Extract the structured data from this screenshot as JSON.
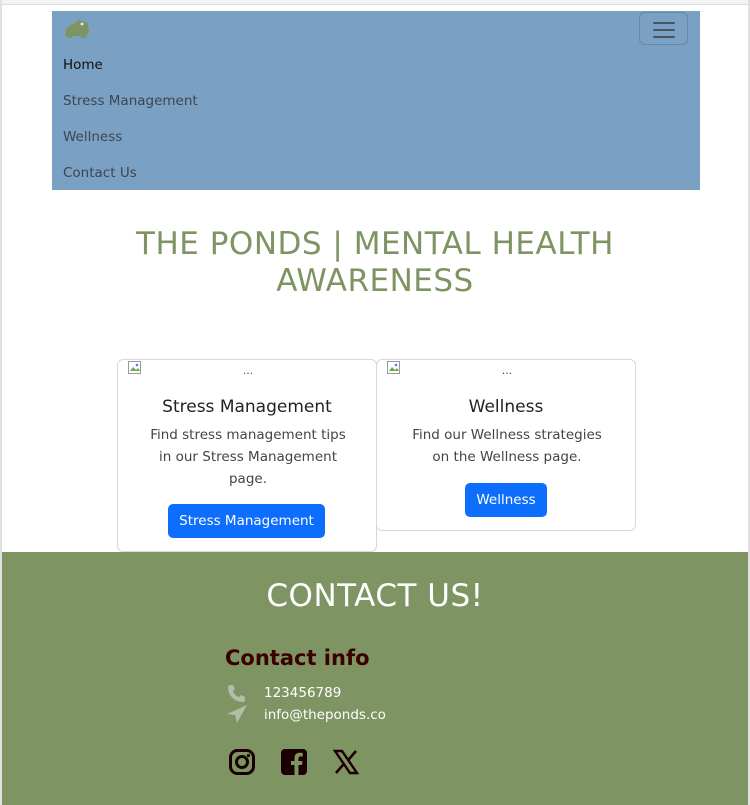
{
  "nav": {
    "items": [
      {
        "label": "Home",
        "active": true
      },
      {
        "label": "Stress Management",
        "active": false
      },
      {
        "label": "Wellness",
        "active": false
      },
      {
        "label": "Contact Us",
        "active": false
      }
    ],
    "brand_icon": "frog-icon",
    "toggler_icon": "hamburger-icon",
    "background": "#7aa0c4"
  },
  "hero": {
    "title": "THE PONDS | MENTAL HEALTH AWARENESS",
    "color": "#7e9462"
  },
  "cards": [
    {
      "img_alt": "...",
      "title": "Stress Management",
      "text": "Find stress management tips in our Stress Management page.",
      "button": "Stress Management"
    },
    {
      "img_alt": "...",
      "title": "Wellness",
      "text": "Find our Wellness strategies on the Wellness page.",
      "button": "Wellness"
    }
  ],
  "footer": {
    "heading": "CONTACT US!",
    "info_heading": "Contact info",
    "phone": "123456789",
    "email": "info@theponds.co",
    "phone_icon": "phone-icon",
    "email_icon": "paper-plane-icon",
    "social": [
      "instagram-icon",
      "facebook-icon",
      "x-icon"
    ],
    "background": "#7e9462"
  },
  "accent": "#0d6efd"
}
